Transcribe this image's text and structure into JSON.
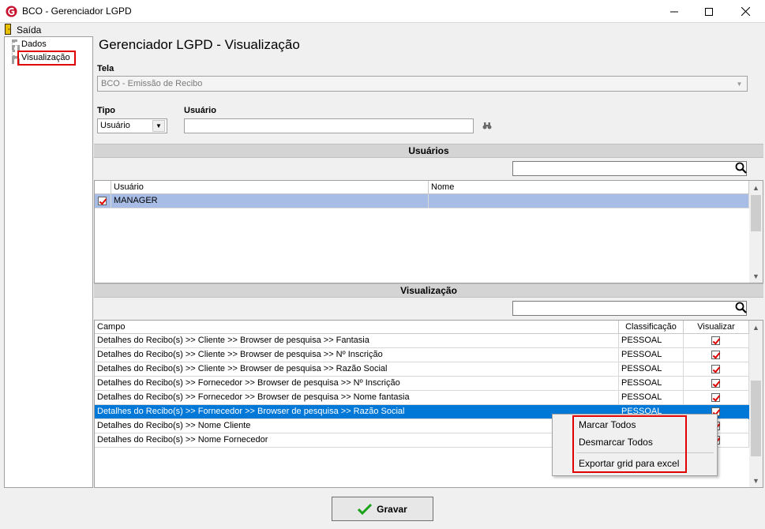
{
  "window": {
    "title": "BCO - Gerenciador LGPD",
    "controls": [
      "minimize-icon",
      "maximize-icon",
      "close-icon"
    ]
  },
  "menu": {
    "saida": "Saída"
  },
  "tree": {
    "items": [
      {
        "label": "Dados"
      },
      {
        "label": "Visualização",
        "selected": true
      }
    ]
  },
  "main": {
    "title": "Gerenciador LGPD - Visualização",
    "tela": {
      "label": "Tela",
      "value": "BCO - Emissão de Recibo"
    },
    "tipo": {
      "label": "Tipo",
      "value": "Usuário"
    },
    "usuario": {
      "label": "Usuário",
      "value": ""
    }
  },
  "usuarios": {
    "section_title": "Usuários",
    "search_value": "",
    "columns": [
      "Usuário",
      "Nome"
    ],
    "rows": [
      {
        "checked": true,
        "usuario": "MANAGER",
        "nome": ""
      }
    ]
  },
  "visualizacao": {
    "section_title": "Visualização",
    "search_value": "",
    "columns": [
      "Campo",
      "Classificação",
      "Visualizar"
    ],
    "rows": [
      {
        "campo": "Detalhes do Recibo(s) >> Cliente >> Browser de pesquisa >> Fantasia",
        "classificacao": "PESSOAL",
        "visualizar": true
      },
      {
        "campo": "Detalhes do Recibo(s) >> Cliente >> Browser de pesquisa >> Nº Inscrição",
        "classificacao": "PESSOAL",
        "visualizar": true
      },
      {
        "campo": "Detalhes do Recibo(s) >> Cliente >> Browser de pesquisa >> Razão Social",
        "classificacao": "PESSOAL",
        "visualizar": true
      },
      {
        "campo": "Detalhes do Recibo(s) >> Fornecedor >> Browser de pesquisa >> Nº Inscrição",
        "classificacao": "PESSOAL",
        "visualizar": true
      },
      {
        "campo": "Detalhes do Recibo(s) >> Fornecedor >> Browser de pesquisa >> Nome fantasia",
        "classificacao": "PESSOAL",
        "visualizar": true
      },
      {
        "campo": "Detalhes do Recibo(s) >> Fornecedor >> Browser de pesquisa >> Razão Social",
        "classificacao": "PESSOAL",
        "visualizar": true,
        "selected": true
      },
      {
        "campo": "Detalhes do Recibo(s) >> Nome Cliente",
        "classificacao": "",
        "visualizar": true
      },
      {
        "campo": "Detalhes do Recibo(s) >> Nome Fornecedor",
        "classificacao": "",
        "visualizar": true
      }
    ]
  },
  "context_menu": {
    "items": [
      "Marcar Todos",
      "Desmarcar Todos",
      "Exportar grid para excel"
    ]
  },
  "footer": {
    "gravar": "Gravar"
  },
  "colors": {
    "selection": "#0078d7",
    "selection_light": "#a8bde6",
    "highlight_border": "#e00000",
    "checkmark": "#e00000"
  }
}
